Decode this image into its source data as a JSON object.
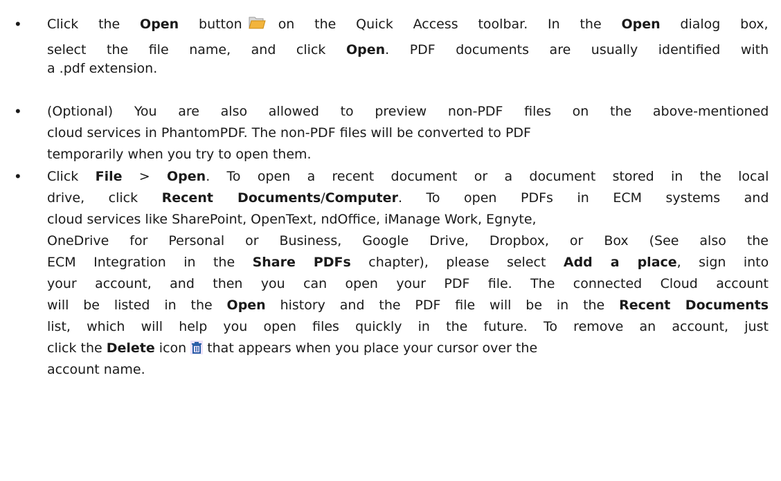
{
  "bullets": [
    {
      "lines": [
        [
          {
            "t": "Click the "
          },
          {
            "t": "Open",
            "b": true
          },
          {
            "t": " button"
          },
          {
            "icon": "open-folder-icon"
          },
          {
            "t": "on the Quick Access toolbar. In the "
          },
          {
            "t": "Open",
            "b": true
          },
          {
            "t": " dialog box,"
          }
        ],
        [
          {
            "t": "select the file name, and click "
          },
          {
            "t": "Open",
            "b": true
          },
          {
            "t": ". PDF documents are usually identified with"
          }
        ],
        [
          {
            "t": "a .pdf extension."
          }
        ]
      ]
    },
    {
      "lines": [
        [
          {
            "t": "(Optional) You are also allowed to preview non-PDF files on the above-mentioned"
          }
        ],
        [
          {
            "t": "cloud services in PhantomPDF. The non-PDF files will be converted to PDF"
          }
        ],
        [
          {
            "t": "temporarily when you try to open them."
          }
        ]
      ]
    },
    {
      "lines": [
        [
          {
            "t": "Click "
          },
          {
            "t": "File",
            "b": true
          },
          {
            "t": " > "
          },
          {
            "t": "Open",
            "b": true
          },
          {
            "t": ". To open a recent document or a document stored in the local"
          }
        ],
        [
          {
            "t": "drive, click "
          },
          {
            "t": "Recent Documents",
            "b": true
          },
          {
            "t": "/"
          },
          {
            "t": "Computer",
            "b": true
          },
          {
            "t": ". To open PDFs in ECM systems and"
          }
        ],
        [
          {
            "t": "cloud services like SharePoint, OpenText, ndOffice, iManage Work, Egnyte,"
          }
        ],
        [
          {
            "t": "OneDrive for Personal or Business, Google Drive, Dropbox, or Box (See also the"
          }
        ],
        [
          {
            "t": "ECM Integration in the "
          },
          {
            "t": "Share PDFs",
            "b": true
          },
          {
            "t": " chapter), please select "
          },
          {
            "t": "Add a place",
            "b": true
          },
          {
            "t": ", sign into"
          }
        ],
        [
          {
            "t": "your account, and then you can open your PDF file. The connected Cloud account"
          }
        ],
        [
          {
            "t": "will be listed in the "
          },
          {
            "t": "Open",
            "b": true
          },
          {
            "t": " history and the PDF file will be in the "
          },
          {
            "t": "Recent Documents",
            "b": true
          }
        ],
        [
          {
            "t": "list, which will help you open files quickly in the future. To remove an account, just"
          }
        ],
        [
          {
            "t": "click the "
          },
          {
            "t": "Delete",
            "b": true
          },
          {
            "t": " icon"
          },
          {
            "icon": "delete-icon"
          },
          {
            "t": "that appears when you place your cursor over the"
          }
        ],
        [
          {
            "t": "account name."
          }
        ]
      ]
    }
  ],
  "bullet_glyph": "•",
  "colors": {
    "text": "#1a1a1a",
    "folder_icon": "#f2b43c",
    "delete_icon": "#2b5fa8",
    "delete_icon_bg": "#ece2f8"
  }
}
